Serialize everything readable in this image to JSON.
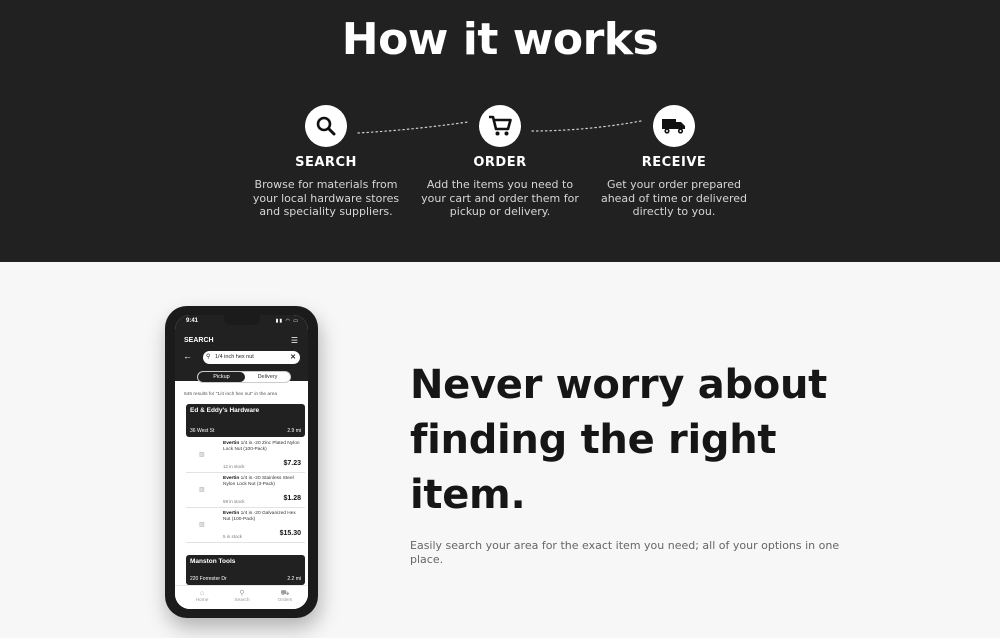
{
  "how_it_works": {
    "title": "How it works",
    "steps": [
      {
        "icon": "search-icon",
        "label": "SEARCH",
        "description": "Browse for materials from your local hardware stores and speciality suppliers."
      },
      {
        "icon": "cart-icon",
        "label": "ORDER",
        "description": "Add the items you need to your cart and order them for pickup or delivery."
      },
      {
        "icon": "truck-icon",
        "label": "RECEIVE",
        "description": "Get your order prepared ahead of time or delivered directly to you."
      }
    ]
  },
  "hero": {
    "title": "Never worry about finding the right item.",
    "subtitle": "Easily search your area for the exact item you need; all of your options in one place."
  },
  "phone": {
    "time": "9:41",
    "header_title": "SEARCH",
    "search_value": "1/4 inch hex nut",
    "toggle": {
      "pickup": "Pickup",
      "delivery": "Delivery"
    },
    "results_text": "645 results for \"1/4 inch hex nut\" in the area",
    "stores": [
      {
        "name": "Ed & Eddy's Hardware",
        "address": "36 West St",
        "distance": "2.9 mi",
        "items": [
          {
            "brand": "Evertin",
            "title": "1/4 in.-20 Zinc Plated Nylon Lock Nut (100-Pack)",
            "stock": "12 in stock",
            "price": "$7.23"
          },
          {
            "brand": "Evertin",
            "title": "1/4 in.-20 Stainless Steel Nylon Lock Nut (3-Pack)",
            "stock": "59 in stock",
            "price": "$1.28"
          },
          {
            "brand": "Evertin",
            "title": "1/4 in.-20 Galvanized Hex Nut (100-Pack)",
            "stock": "5 in stock",
            "price": "$15.30"
          }
        ]
      },
      {
        "name": "Manston Tools",
        "address": "220 Forrester Dr",
        "distance": "2.2 mi"
      }
    ],
    "nav": [
      {
        "icon": "home-icon",
        "label": "Home"
      },
      {
        "icon": "search-icon",
        "label": "Search"
      },
      {
        "icon": "truck-icon",
        "label": "Orders"
      }
    ]
  },
  "colors": {
    "dark_band": "#212121",
    "page_bg": "#f7f7f7",
    "text_dark": "#161616"
  }
}
